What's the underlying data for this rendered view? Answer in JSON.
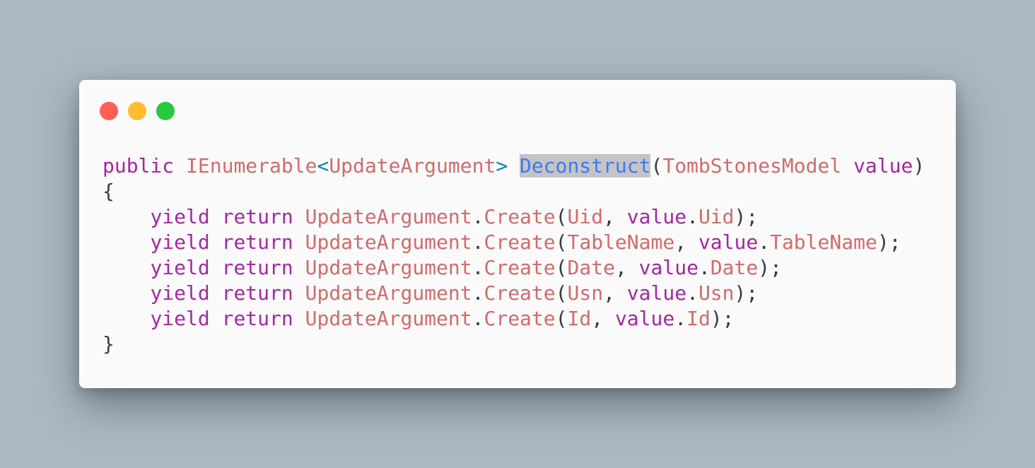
{
  "window": {
    "controls": [
      {
        "name": "close",
        "color": "#ff5f56"
      },
      {
        "name": "minimize",
        "color": "#ffbd2e"
      },
      {
        "name": "maximize",
        "color": "#27c93f"
      }
    ]
  },
  "colors": {
    "background": "#abb8c3",
    "window": "#fafafa",
    "keyword": "#a626a4",
    "type": "#d46a6a",
    "operator": "#0184bc",
    "function": "#4078f2",
    "plain": "#383a42",
    "selection": "#c4c4c4"
  },
  "code": {
    "signature": {
      "kw_public": "public",
      "type_ienumerable": "IEnumerable",
      "lt": "<",
      "type_arg": "UpdateArgument",
      "gt": ">",
      "method": "Deconstruct",
      "open_paren": "(",
      "param_type": "TombStonesModel",
      "param_name": "value",
      "close_paren": ")"
    },
    "open_brace": "{",
    "close_brace": "}",
    "indent": "    ",
    "yield_kw": "yield",
    "return_kw": "return",
    "class_name": "UpdateArgument",
    "method_call": "Create",
    "value_name": "value",
    "lines": [
      {
        "arg": "Uid",
        "prop": "Uid"
      },
      {
        "arg": "TableName",
        "prop": "TableName"
      },
      {
        "arg": "Date",
        "prop": "Date"
      },
      {
        "arg": "Usn",
        "prop": "Usn"
      },
      {
        "arg": "Id",
        "prop": "Id"
      }
    ]
  }
}
